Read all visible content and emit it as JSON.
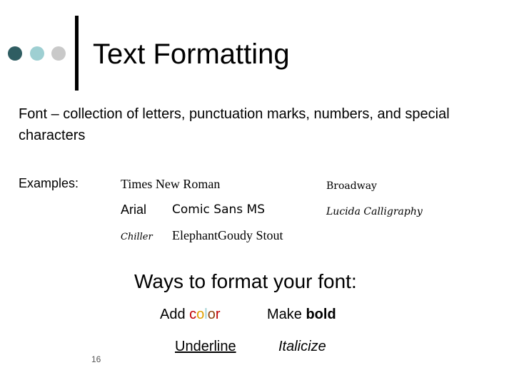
{
  "slide": {
    "title": "Text Formatting",
    "description": "Font – collection of letters, punctuation marks, numbers, and special characters",
    "examples_label": "Examples:",
    "fonts": {
      "times": "Times New Roman",
      "broadway": "Broadway",
      "arial": "Arial",
      "comic": "Comic Sans MS",
      "lucida": "Lucida Calligraphy",
      "chiller": "Chiller",
      "elephant": "Elephant",
      "goudy": "Goudy Stout"
    },
    "ways_heading": "Ways to format your font:",
    "options": {
      "add_prefix": "Add ",
      "color_letters": [
        "c",
        "o",
        "l",
        "o",
        "r"
      ],
      "make_prefix": "Make ",
      "bold_word": "bold",
      "underline": "Underline",
      "italicize": "Italicize"
    },
    "page_number": "16"
  },
  "colors": {
    "dot_dark": "#2f5d62",
    "dot_light": "#9ecfd2",
    "dot_gray": "#c9c9c9",
    "color_word": [
      "#c00000",
      "#e0a000",
      "#9ecfd2",
      "#8b4513",
      "#c00000"
    ]
  }
}
